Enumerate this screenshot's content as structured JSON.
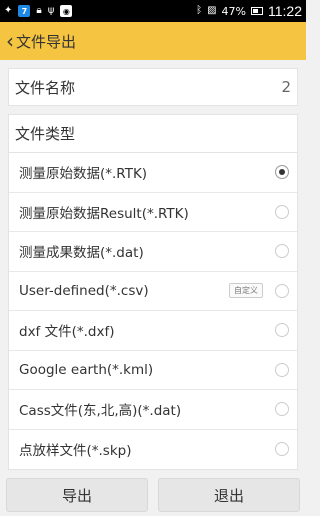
{
  "status_bar": {
    "battery": "47%",
    "time": "11:22"
  },
  "app_bar": {
    "title": "文件导出"
  },
  "file_name": {
    "label": "文件名称",
    "value": "2"
  },
  "file_type": {
    "header": "文件类型",
    "custom_label": "自定义",
    "options": [
      {
        "label": "测量原始数据(*.RTK)",
        "selected": true
      },
      {
        "label": "测量原始数据Result(*.RTK)",
        "selected": false
      },
      {
        "label": "测量成果数据(*.dat)",
        "selected": false
      },
      {
        "label": "User-defined(*.csv)",
        "selected": false
      },
      {
        "label": "dxf 文件(*.dxf)",
        "selected": false
      },
      {
        "label": "Google earth(*.kml)",
        "selected": false
      },
      {
        "label": "Cass文件(东,北,高)(*.dat)",
        "selected": false
      },
      {
        "label": "点放样文件(*.skp)",
        "selected": false
      }
    ]
  },
  "buttons": {
    "export": "导出",
    "exit": "退出"
  }
}
